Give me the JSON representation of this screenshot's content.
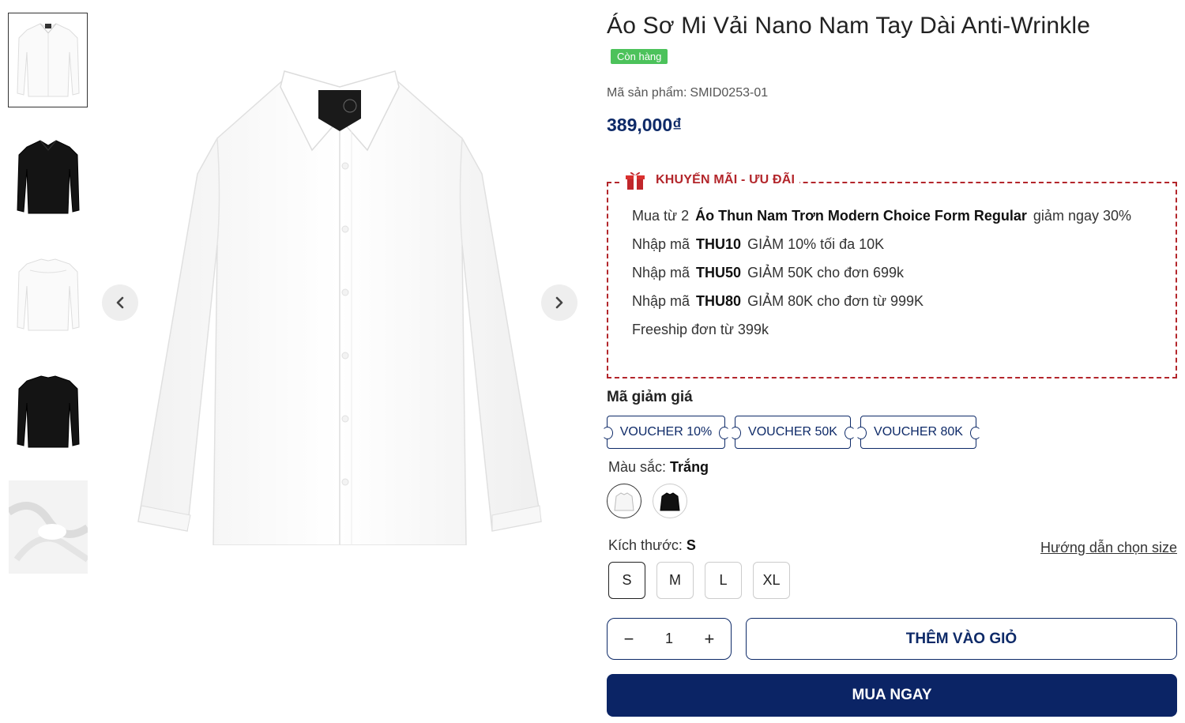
{
  "product": {
    "title": "Áo Sơ Mi Vải Nano Nam Tay Dài Anti-Wrinkle",
    "stock_badge": "Còn hàng",
    "sku_label": "Mã sản phẩm:",
    "sku": "SMID0253-01",
    "price": "389,000₫"
  },
  "gallery": {
    "thumbnails": [
      {
        "name": "white-shirt-front",
        "color": "#ffffff"
      },
      {
        "name": "black-shirt-front",
        "color": "#111111"
      },
      {
        "name": "white-shirt-back",
        "color": "#ffffff"
      },
      {
        "name": "black-shirt-back",
        "color": "#111111"
      },
      {
        "name": "white-fabric-closeup",
        "color": "#f2f2f2"
      }
    ],
    "prev_icon": "chevron-left-icon",
    "next_icon": "chevron-right-icon"
  },
  "promo": {
    "title": "KHUYẾN MÃI - ƯU ĐÃI",
    "icon": "gift-icon",
    "accent_color": "#b3262b",
    "items": [
      {
        "pre": "Mua từ 2",
        "bold": "Áo Thun Nam Trơn Modern Choice Form Regular",
        "post": "giảm ngay 30%"
      },
      {
        "pre": "Nhập mã",
        "bold": "THU10",
        "post": "GIẢM 10% tối đa 10K"
      },
      {
        "pre": "Nhập mã",
        "bold": "THU50",
        "post": "GIẢM 50K cho đơn 699k"
      },
      {
        "pre": "Nhập mã",
        "bold": "THU80",
        "post": "GIẢM 80K cho đơn từ 999K"
      },
      {
        "pre": "Freeship đơn từ 399k",
        "bold": "",
        "post": ""
      }
    ]
  },
  "vouchers": {
    "heading": "Mã giảm giá",
    "items": [
      "VOUCHER 10%",
      "VOUCHER 50K",
      "VOUCHER 80K"
    ]
  },
  "color": {
    "label": "Màu sắc:",
    "selected": "Trắng",
    "options": [
      {
        "name": "white",
        "hex": "#ffffff"
      },
      {
        "name": "black",
        "hex": "#111111"
      }
    ]
  },
  "size": {
    "label": "Kích thước:",
    "selected": "S",
    "guide": "Hướng dẫn chọn size",
    "options": [
      "S",
      "M",
      "L",
      "XL"
    ]
  },
  "cart": {
    "minus": "−",
    "quantity": "1",
    "plus": "+",
    "add_to_cart": "THÊM VÀO GIỎ",
    "buy_now": "MUA NGAY",
    "brand_color": "#0e2a68"
  }
}
